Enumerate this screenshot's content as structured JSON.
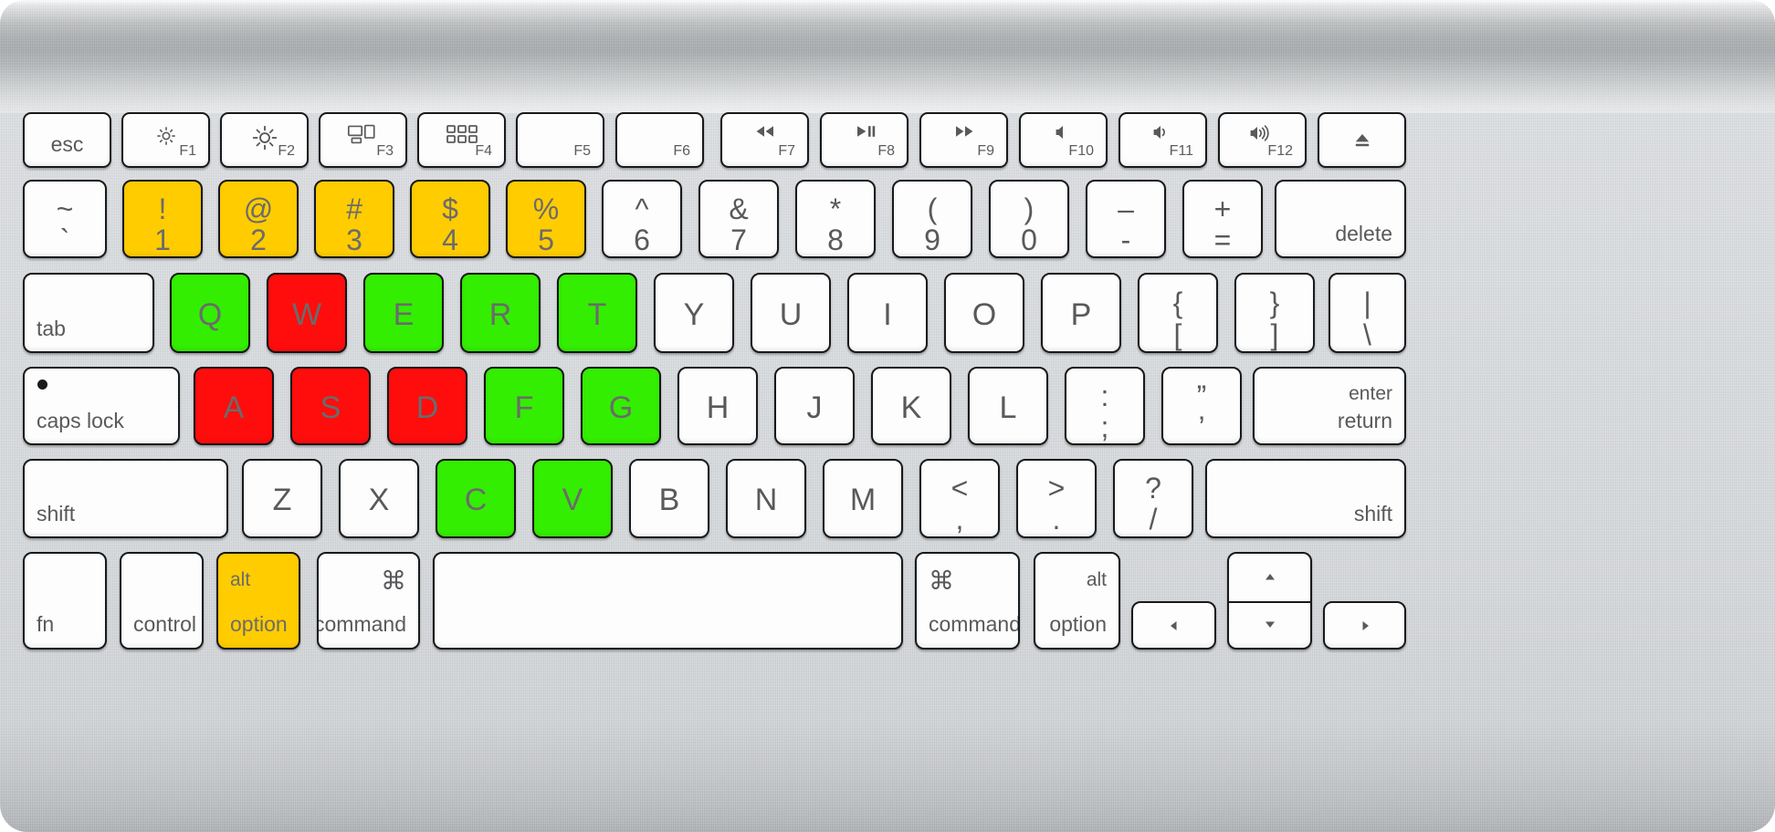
{
  "device": {
    "name": "Apple Wireless Keyboard",
    "body_color": "#cfd2d5",
    "key_face_color": "#fdfdfd",
    "key_border_color": "#18191b",
    "legend_color": "#59595c"
  },
  "highlight_colors": {
    "yellow": "#FFCC00",
    "green": "#33EE00",
    "red": "#FF0D0D",
    "none": "#fdfdfd"
  },
  "highlighted_keys": {
    "yellow": [
      "1",
      "2",
      "3",
      "4",
      "5",
      "option-left"
    ],
    "green": [
      "Q",
      "E",
      "R",
      "T",
      "F",
      "G",
      "C",
      "V"
    ],
    "red": [
      "W",
      "A",
      "S",
      "D"
    ]
  },
  "rows": {
    "function_row": [
      {
        "name": "esc",
        "label": "esc",
        "fn": "",
        "icon": "",
        "color": "none"
      },
      {
        "name": "f1",
        "label": "",
        "fn": "F1",
        "icon": "brightness-down-icon",
        "color": "none"
      },
      {
        "name": "f2",
        "label": "",
        "fn": "F2",
        "icon": "brightness-up-icon",
        "color": "none"
      },
      {
        "name": "f3",
        "label": "",
        "fn": "F3",
        "icon": "mission-control-icon",
        "color": "none"
      },
      {
        "name": "f4",
        "label": "",
        "fn": "F4",
        "icon": "launchpad-icon",
        "color": "none"
      },
      {
        "name": "f5",
        "label": "",
        "fn": "F5",
        "icon": "",
        "color": "none"
      },
      {
        "name": "f6",
        "label": "",
        "fn": "F6",
        "icon": "",
        "color": "none"
      },
      {
        "name": "f7",
        "label": "",
        "fn": "F7",
        "icon": "rewind-icon",
        "color": "none"
      },
      {
        "name": "f8",
        "label": "",
        "fn": "F8",
        "icon": "play-pause-icon",
        "color": "none"
      },
      {
        "name": "f9",
        "label": "",
        "fn": "F9",
        "icon": "fast-forward-icon",
        "color": "none"
      },
      {
        "name": "f10",
        "label": "",
        "fn": "F10",
        "icon": "mute-icon",
        "color": "none"
      },
      {
        "name": "f11",
        "label": "",
        "fn": "F11",
        "icon": "volume-down-icon",
        "color": "none"
      },
      {
        "name": "f12",
        "label": "",
        "fn": "F12",
        "icon": "volume-up-icon",
        "color": "none"
      },
      {
        "name": "eject",
        "label": "",
        "fn": "",
        "icon": "eject-icon",
        "color": "none"
      }
    ],
    "number_row": [
      {
        "name": "backtick",
        "upper": "~",
        "lower": "`",
        "color": "none"
      },
      {
        "name": "1",
        "upper": "!",
        "lower": "1",
        "color": "yellow"
      },
      {
        "name": "2",
        "upper": "@",
        "lower": "2",
        "color": "yellow"
      },
      {
        "name": "3",
        "upper": "#",
        "lower": "3",
        "color": "yellow"
      },
      {
        "name": "4",
        "upper": "$",
        "lower": "4",
        "color": "yellow"
      },
      {
        "name": "5",
        "upper": "%",
        "lower": "5",
        "color": "yellow"
      },
      {
        "name": "6",
        "upper": "^",
        "lower": "6",
        "color": "none"
      },
      {
        "name": "7",
        "upper": "&",
        "lower": "7",
        "color": "none"
      },
      {
        "name": "8",
        "upper": "*",
        "lower": "8",
        "color": "none"
      },
      {
        "name": "9",
        "upper": "(",
        "lower": "9",
        "color": "none"
      },
      {
        "name": "0",
        "upper": ")",
        "lower": "0",
        "color": "none"
      },
      {
        "name": "minus",
        "upper": "–",
        "lower": "-",
        "color": "none"
      },
      {
        "name": "equal",
        "upper": "+",
        "lower": "=",
        "color": "none"
      },
      {
        "name": "delete",
        "label": "delete",
        "color": "none"
      }
    ],
    "top_row": [
      {
        "name": "tab",
        "label": "tab",
        "color": "none"
      },
      {
        "name": "Q",
        "letter": "Q",
        "color": "green"
      },
      {
        "name": "W",
        "letter": "W",
        "color": "red"
      },
      {
        "name": "E",
        "letter": "E",
        "color": "green"
      },
      {
        "name": "R",
        "letter": "R",
        "color": "green"
      },
      {
        "name": "T",
        "letter": "T",
        "color": "green"
      },
      {
        "name": "Y",
        "letter": "Y",
        "color": "none"
      },
      {
        "name": "U",
        "letter": "U",
        "color": "none"
      },
      {
        "name": "I",
        "letter": "I",
        "color": "none"
      },
      {
        "name": "O",
        "letter": "O",
        "color": "none"
      },
      {
        "name": "P",
        "letter": "P",
        "color": "none"
      },
      {
        "name": "bracket-left",
        "upper": "{",
        "lower": "[",
        "color": "none"
      },
      {
        "name": "bracket-right",
        "upper": "}",
        "lower": "]",
        "color": "none"
      },
      {
        "name": "backslash",
        "upper": "|",
        "lower": "\\",
        "color": "none"
      }
    ],
    "home_row": [
      {
        "name": "caps-lock",
        "label": "caps lock",
        "color": "none"
      },
      {
        "name": "A",
        "letter": "A",
        "color": "red"
      },
      {
        "name": "S",
        "letter": "S",
        "color": "red"
      },
      {
        "name": "D",
        "letter": "D",
        "color": "red"
      },
      {
        "name": "F",
        "letter": "F",
        "color": "green"
      },
      {
        "name": "G",
        "letter": "G",
        "color": "green"
      },
      {
        "name": "H",
        "letter": "H",
        "color": "none"
      },
      {
        "name": "J",
        "letter": "J",
        "color": "none"
      },
      {
        "name": "K",
        "letter": "K",
        "color": "none"
      },
      {
        "name": "L",
        "letter": "L",
        "color": "none"
      },
      {
        "name": "semicolon",
        "upper": ":",
        "lower": ";",
        "color": "none"
      },
      {
        "name": "quote",
        "upper": "”",
        "lower": "’",
        "color": "none"
      },
      {
        "name": "return",
        "upper_label": "enter",
        "lower_label": "return",
        "color": "none"
      }
    ],
    "bottom_letter_row": [
      {
        "name": "shift-left",
        "label": "shift",
        "color": "none"
      },
      {
        "name": "Z",
        "letter": "Z",
        "color": "none"
      },
      {
        "name": "X",
        "letter": "X",
        "color": "none"
      },
      {
        "name": "C",
        "letter": "C",
        "color": "green"
      },
      {
        "name": "V",
        "letter": "V",
        "color": "green"
      },
      {
        "name": "B",
        "letter": "B",
        "color": "none"
      },
      {
        "name": "N",
        "letter": "N",
        "color": "none"
      },
      {
        "name": "M",
        "letter": "M",
        "color": "none"
      },
      {
        "name": "comma",
        "upper": "<",
        "lower": ",",
        "color": "none"
      },
      {
        "name": "period",
        "upper": ">",
        "lower": ".",
        "color": "none"
      },
      {
        "name": "slash",
        "upper": "?",
        "lower": "/",
        "color": "none"
      },
      {
        "name": "shift-right",
        "label": "shift",
        "color": "none"
      }
    ],
    "modifier_row": [
      {
        "name": "fn",
        "label": "fn",
        "color": "none"
      },
      {
        "name": "control",
        "label": "control",
        "color": "none"
      },
      {
        "name": "option-left",
        "upper_label": "alt",
        "lower_label": "option",
        "color": "yellow"
      },
      {
        "name": "command-left",
        "symbol": "⌘",
        "lower_label": "command",
        "color": "none"
      },
      {
        "name": "space",
        "label": "",
        "color": "none"
      },
      {
        "name": "command-right",
        "symbol": "⌘",
        "lower_label": "command",
        "color": "none"
      },
      {
        "name": "option-right",
        "upper_label": "alt",
        "lower_label": "option",
        "color": "none"
      },
      {
        "name": "arrow-left",
        "icon": "arrow-left-icon",
        "color": "none"
      },
      {
        "name": "arrow-up",
        "icon": "arrow-up-icon",
        "color": "none"
      },
      {
        "name": "arrow-down",
        "icon": "arrow-down-icon",
        "color": "none"
      },
      {
        "name": "arrow-right",
        "icon": "arrow-right-icon",
        "color": "none"
      }
    ]
  }
}
